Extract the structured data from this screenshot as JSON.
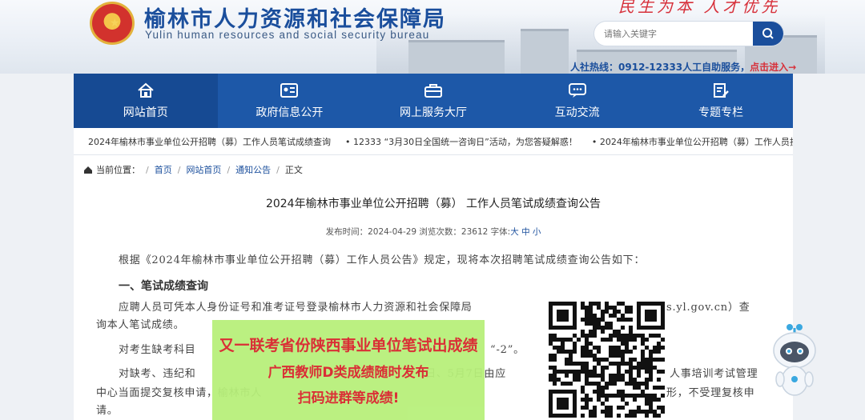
{
  "header": {
    "site_title": "榆林市人力资源和社会保障局",
    "site_subtitle": "Yulin human resources and social security bureau",
    "slogan": "民生为本  人才优先",
    "search_placeholder": "请输入关键字",
    "hotline_label": "人社热线：",
    "hotline_number": "0912-12333",
    "hotline_service": "人工自助服务，",
    "hotline_link": "点击进入→"
  },
  "nav": [
    {
      "label": "网站首页",
      "icon": "home-icon"
    },
    {
      "label": "政府信息公开",
      "icon": "id-card-icon"
    },
    {
      "label": "网上服务大厅",
      "icon": "briefcase-icon"
    },
    {
      "label": "互动交流",
      "icon": "chat-icon"
    },
    {
      "label": "专题专栏",
      "icon": "edit-doc-icon"
    }
  ],
  "ticker": [
    "2024年榆林市事业单位公开招聘（募）工作人员笔试成绩查询",
    "• 12333 “3月30日全国统一咨询日”活动，为您答疑解惑！",
    "• 2024年榆林市事业单位公开招聘（募）工作人员抗"
  ],
  "breadcrumb": {
    "label": "当前位置：",
    "items": [
      "首页",
      "网站首页",
      "通知公告"
    ],
    "current": "正文"
  },
  "article": {
    "title": "2024年榆林市事业单位公开招聘（募） 工作人员笔试成绩查询公告",
    "meta_prefix": "发布时间：2024-04-29 浏览次数：23612 字体:",
    "font_large": "大",
    "font_mid": "中",
    "font_small": "小",
    "para1": "根据《2024年榆林市事业单位公开招聘（募）工作人员公告》规定，现将本次招聘笔试成绩查询公告如下：",
    "heading1": "一、笔试成绩查询",
    "para2a": "应聘人员可凭本人身份证号和准考证号登录榆林市人力资源和社会保障局",
    "para2b": "s.yl.gov.cn）查",
    "para2c": "询本人笔试成绩。",
    "para3a": "对考生缺考科目",
    "para3b": "“-2”。",
    "para4a": "对缺考、违纪和",
    "para4b": "6日、5月7日由应",
    "para4c": "人事培训考试管理",
    "para5a": "中心当面提交复核申请，榆林市人",
    "para5b": "形，不受理复核申",
    "para6": "请。"
  },
  "promo": {
    "line1": "又一联考省份陕西事业单位笔试出成绩",
    "line2": "广西教师D类成绩随时发布",
    "line3": "扫码进群等成绩!"
  },
  "colors": {
    "brand": "#1d58a8",
    "accent": "#d7303a",
    "promo_bg": "#b7f07a"
  }
}
